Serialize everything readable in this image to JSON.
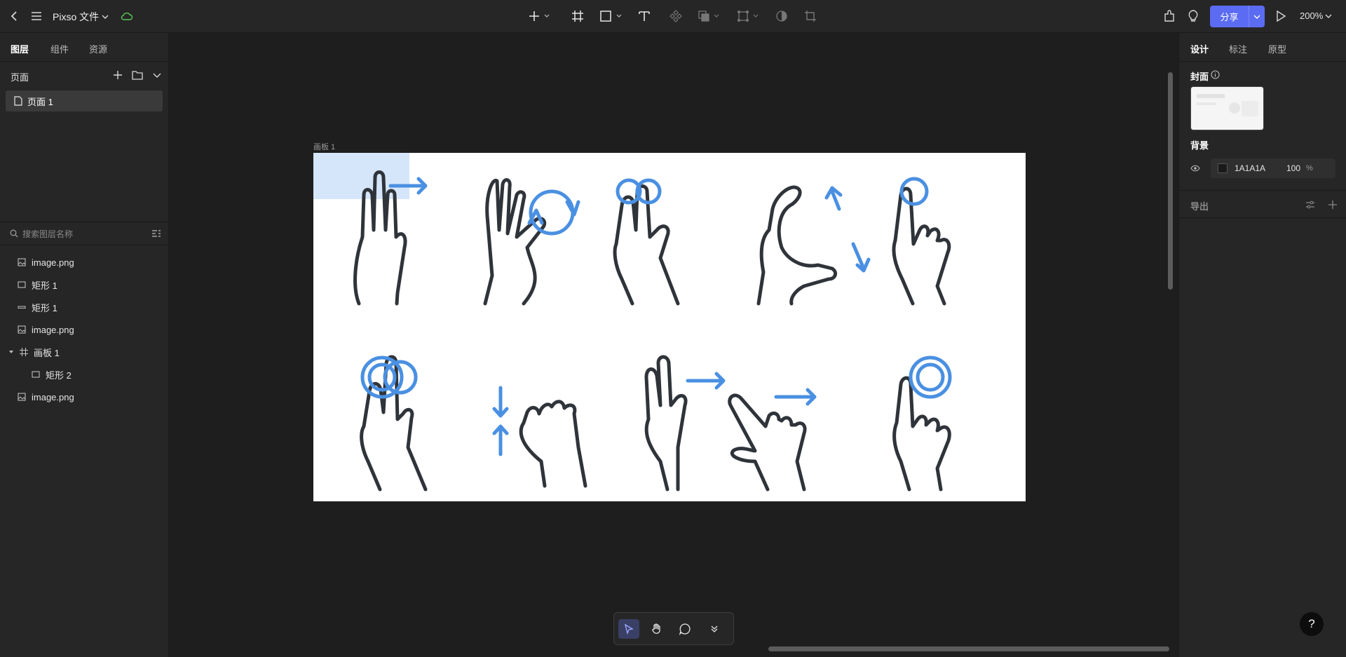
{
  "app": {
    "file_title": "Pixso 文件",
    "share_label": "分享",
    "zoom": "200%"
  },
  "left_panel": {
    "tabs": [
      {
        "label": "图层",
        "active": true
      },
      {
        "label": "组件",
        "active": false
      },
      {
        "label": "资源",
        "active": false
      }
    ],
    "pages_title": "页面",
    "pages": [
      {
        "label": "页面 1",
        "selected": true
      }
    ],
    "search_placeholder": "搜索图层名称",
    "layers": [
      {
        "label": "image.png",
        "icon": "image-icon",
        "indent": 0
      },
      {
        "label": "矩形 1",
        "icon": "rectangle-icon",
        "indent": 0
      },
      {
        "label": "矩形 1",
        "icon": "line-icon",
        "indent": 0
      },
      {
        "label": "image.png",
        "icon": "image-icon",
        "indent": 0
      },
      {
        "label": "画板 1",
        "icon": "frame-icon",
        "indent": 0,
        "expanded": true
      },
      {
        "label": "矩形 2",
        "icon": "rectangle-icon",
        "indent": 1
      },
      {
        "label": "image.png",
        "icon": "image-icon",
        "indent": 0
      }
    ]
  },
  "canvas": {
    "artboard_label": "画板 1"
  },
  "right_panel": {
    "tabs": [
      {
        "label": "设计",
        "active": true
      },
      {
        "label": "标注",
        "active": false
      },
      {
        "label": "原型",
        "active": false
      }
    ],
    "cover_label": "封面",
    "background_label": "背景",
    "background_hex": "1A1A1A",
    "background_opacity": "100",
    "background_opacity_unit": "%",
    "export_label": "导出"
  },
  "help_label": "?",
  "colors": {
    "accent": "#5b6cf2",
    "gesture_blue": "#4a90e2",
    "gesture_dark": "#2f343a"
  }
}
